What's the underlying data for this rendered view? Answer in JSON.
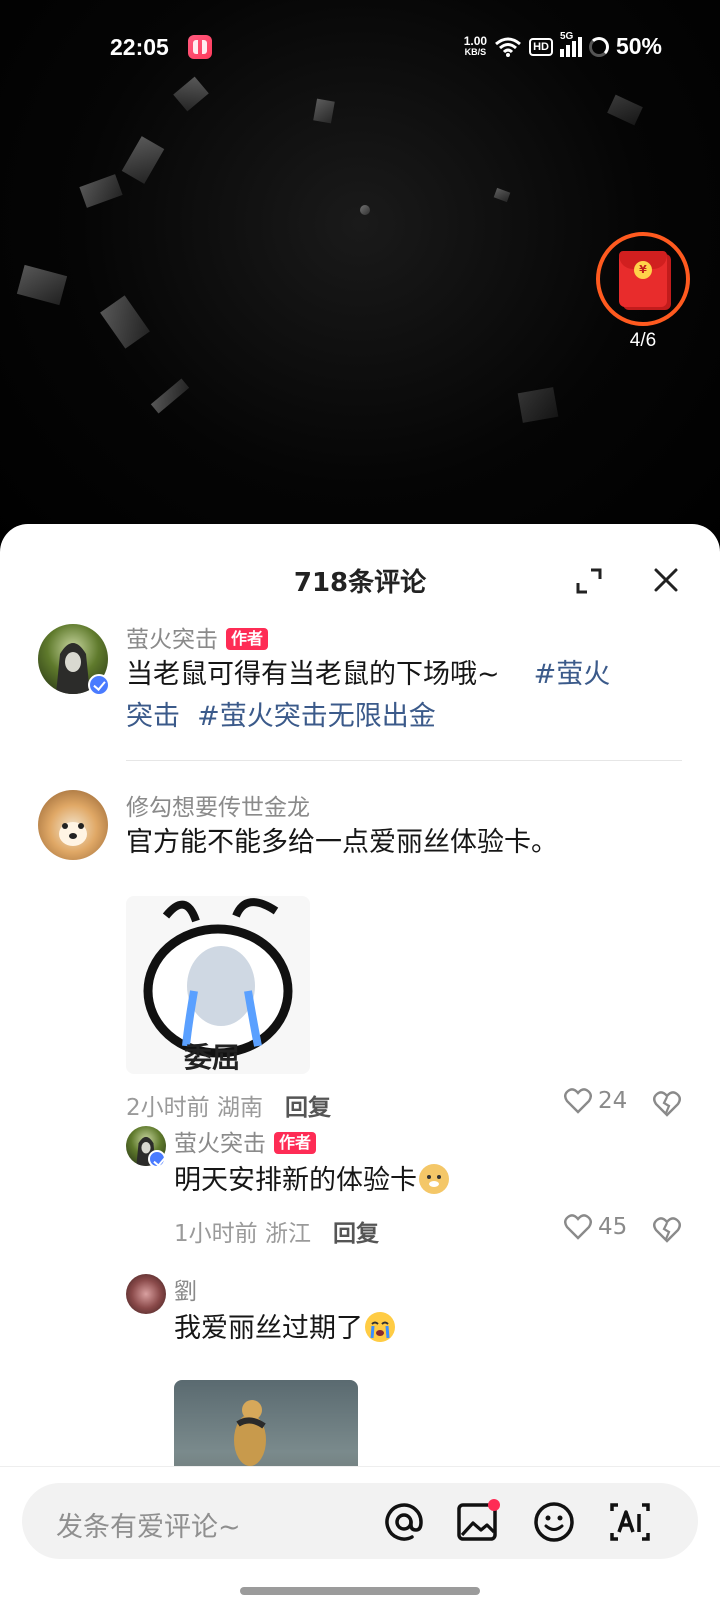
{
  "status_bar": {
    "time": "22:05",
    "net_speed_value": "1.00",
    "net_speed_unit": "KB/S",
    "hd": "HD",
    "network": "5G",
    "battery": "50%"
  },
  "red_packet": {
    "progress": "4/6",
    "icon": "red-envelope-icon"
  },
  "sheet": {
    "title": "718条评论",
    "expand_icon": "expand-icon",
    "close_icon": "close-icon"
  },
  "comments": [
    {
      "username": "萤火突击",
      "badge": "作者",
      "text": "当老鼠可得有当老鼠的下场哦~",
      "tags": [
        "#萤火",
        "突击",
        "#萤火突击无限出金"
      ]
    },
    {
      "username": "修勾想要传世金龙",
      "text": "官方能不能多给一点爱丽丝体验卡。",
      "sticker_caption": "委屈",
      "time": "2小时前",
      "location": "湖南",
      "reply_label": "回复",
      "likes": "24"
    },
    {
      "username": "萤火突击",
      "badge": "作者",
      "text": "明天安排新的体验卡",
      "emoji": "doge-emoji",
      "time": "1小时前",
      "location": "浙江",
      "reply_label": "回复",
      "likes": "45"
    },
    {
      "username": "劉",
      "text": "我爱丽丝过期了",
      "emoji": "crying-emoji"
    }
  ],
  "input_bar": {
    "placeholder": "发条有爱评论~",
    "icons": [
      "at-icon",
      "image-icon",
      "emoji-icon",
      "ai-icon"
    ]
  },
  "colors": {
    "accent": "#fe2c55",
    "tag": "#3b5a8a",
    "redpack_ring": "#ff5a1f"
  }
}
